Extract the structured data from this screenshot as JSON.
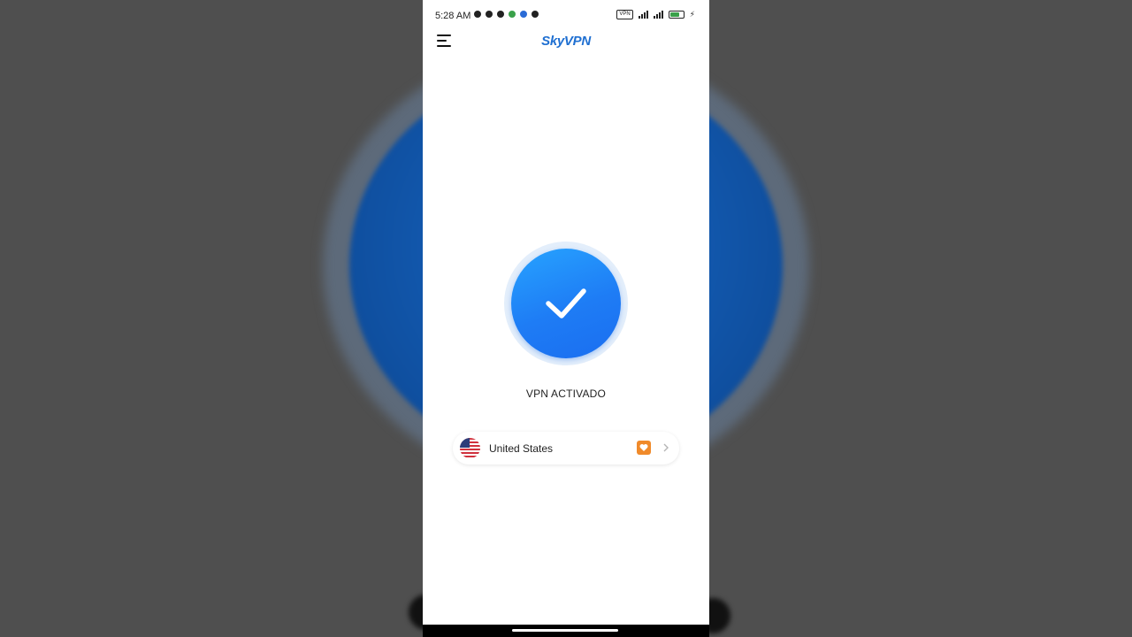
{
  "status_bar": {
    "time": "5:28 AM",
    "vpn_label": "VPN",
    "battery_level": 0.6,
    "signal_bars": 4
  },
  "header": {
    "menu_icon": "hamburger-menu-icon",
    "brand": "SkyVPN"
  },
  "main": {
    "connect_icon": "checkmark-icon",
    "connection_status": "VPN ACTIVADO"
  },
  "server": {
    "country": "United States",
    "flag_icon": "us-flag-icon",
    "badge_icon": "premium-heart-icon",
    "arrow_icon": "chevron-right-icon"
  },
  "colors": {
    "brand": "#1f6fd1",
    "connect_button": "#1e7cf5",
    "premium_badge": "#f08a2a"
  }
}
